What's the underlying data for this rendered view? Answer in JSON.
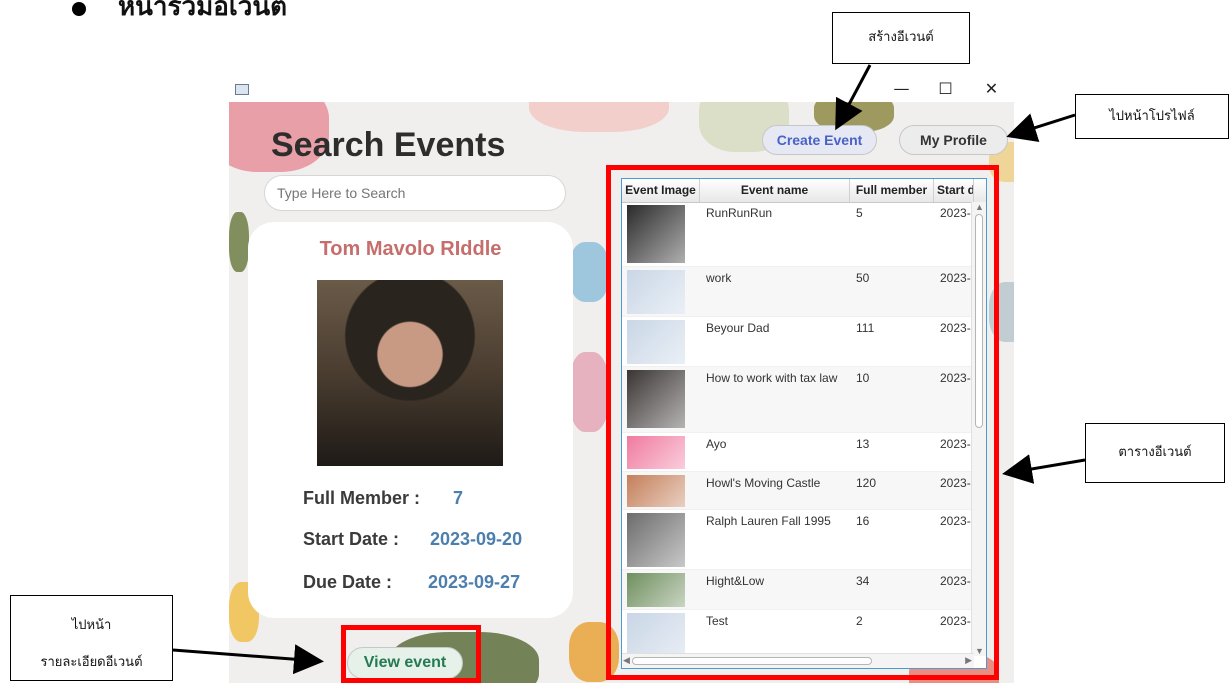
{
  "doc": {
    "heading": "หน้ารวมอีเวนต์"
  },
  "window": {
    "minimize": "—",
    "maximize": "☐",
    "close": "✕"
  },
  "app": {
    "title": "Search Events",
    "search_placeholder": "Type Here to Search",
    "create_button": "Create Event",
    "profile_button": "My Profile",
    "view_button": "View event",
    "card": {
      "name": "Tom Mavolo RIddle",
      "full_member_label": "Full Member :",
      "full_member_value": "7",
      "start_label": "Start Date :",
      "start_value": "2023-09-20",
      "due_label": "Due Date :",
      "due_value": "2023-09-27"
    }
  },
  "table": {
    "headers": [
      "Event Image",
      "Event name",
      "Full member",
      "Start d"
    ],
    "rows": [
      {
        "name": "RunRunRun",
        "members": "5",
        "start": "2023-",
        "thumb": "lost-poster",
        "thumb_color": "#2a2a2a"
      },
      {
        "name": "work",
        "members": "50",
        "start": "2023-",
        "thumb": "pastel-clouds",
        "thumb_color": "#c9d6e6"
      },
      {
        "name": "Beyour Dad",
        "members": "111",
        "start": "2023-",
        "thumb": "pastel-clouds",
        "thumb_color": "#c9d6e6"
      },
      {
        "name": "How to work with tax law",
        "members": "10",
        "start": "2023-",
        "thumb": "statue",
        "thumb_color": "#3a3533"
      },
      {
        "name": "Ayo",
        "members": "13",
        "start": "2023-",
        "thumb": "pink-pattern",
        "thumb_color": "#f07aa0"
      },
      {
        "name": "Howl's Moving Castle",
        "members": "120",
        "start": "2023-",
        "thumb": "anime",
        "thumb_color": "#c47f5a"
      },
      {
        "name": "Ralph Lauren Fall 1995",
        "members": "16",
        "start": "2023-",
        "thumb": "fashion",
        "thumb_color": "#6c6c6c"
      },
      {
        "name": "Hight&Low",
        "members": "34",
        "start": "2023-",
        "thumb": "portrait",
        "thumb_color": "#6f8f5e"
      },
      {
        "name": "Test",
        "members": "2",
        "start": "2023-",
        "thumb": "pastel-clouds",
        "thumb_color": "#c9d6e6"
      }
    ]
  },
  "annotations": {
    "create": "สร้างอีเวนต์",
    "profile": "ไปหน้าโปรไฟล์",
    "table": "ตารางอีเวนต์",
    "view_line1": "ไปหน้า",
    "view_line2": "รายละเอียดอีเวนต์"
  }
}
